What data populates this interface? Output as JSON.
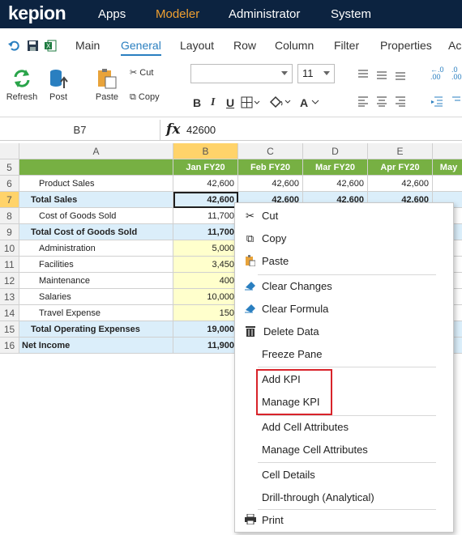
{
  "app": {
    "logo": "kepion"
  },
  "nav": [
    "Apps",
    "Modeler",
    "Administrator",
    "System"
  ],
  "tabs": [
    "Main",
    "General",
    "Layout",
    "Row",
    "Column",
    "Filter",
    "Properties",
    "Ac"
  ],
  "ribbon": {
    "refresh": "Refresh",
    "post": "Post",
    "paste": "Paste",
    "cut": "Cut",
    "copy": "Copy",
    "font_name": "",
    "font_size": "11",
    "bold": "B",
    "italic": "I",
    "underline": "U",
    "font_color": "A",
    "decimal_inc": ".0\n.00",
    "decimal_dec": ".00\n.0"
  },
  "formula_bar": {
    "cell": "B7",
    "fx": "fx",
    "value": "42600"
  },
  "columns": [
    "A",
    "B",
    "C",
    "D",
    "E",
    ""
  ],
  "rows": [
    {
      "num": "5",
      "label": "",
      "values": [
        "Jan FY20",
        "Feb FY20",
        "Mar FY20",
        "Apr FY20",
        "May"
      ]
    },
    {
      "num": "6",
      "label": "Product Sales",
      "values": [
        "42,600",
        "42,600",
        "42,600",
        "42,600",
        ""
      ]
    },
    {
      "num": "7",
      "label": "Total Sales",
      "values": [
        "42,600",
        "42,600",
        "42,600",
        "42,600",
        ""
      ]
    },
    {
      "num": "8",
      "label": "Cost of Goods Sold",
      "values": [
        "11,700",
        "",
        "",
        "",
        ""
      ]
    },
    {
      "num": "9",
      "label": "Total Cost of Goods Sold",
      "values": [
        "11,700",
        "",
        "",
        "",
        ""
      ]
    },
    {
      "num": "10",
      "label": "Administration",
      "values": [
        "5,000",
        "",
        "",
        "",
        ""
      ]
    },
    {
      "num": "11",
      "label": "Facilities",
      "values": [
        "3,450",
        "",
        "",
        "",
        ""
      ]
    },
    {
      "num": "12",
      "label": "Maintenance",
      "values": [
        "400",
        "",
        "",
        "",
        ""
      ]
    },
    {
      "num": "13",
      "label": "Salaries",
      "values": [
        "10,000",
        "",
        "",
        "",
        ""
      ]
    },
    {
      "num": "14",
      "label": "Travel Expense",
      "values": [
        "150",
        "",
        "",
        "",
        ""
      ]
    },
    {
      "num": "15",
      "label": "Total Operating Expenses",
      "values": [
        "19,000",
        "",
        "",
        "",
        ""
      ]
    },
    {
      "num": "16",
      "label": "Net Income",
      "values": [
        "11,900",
        "",
        "",
        "",
        ""
      ]
    }
  ],
  "context_menu": {
    "cut": "Cut",
    "copy": "Copy",
    "paste": "Paste",
    "clear_changes": "Clear Changes",
    "clear_formula": "Clear Formula",
    "delete_data": "Delete Data",
    "freeze_pane": "Freeze Pane",
    "add_kpi": "Add KPI",
    "manage_kpi": "Manage KPI",
    "add_cell_attributes": "Add Cell Attributes",
    "manage_cell_attributes": "Manage Cell Attributes",
    "cell_details": "Cell Details",
    "drill_through": "Drill-through (Analytical)",
    "print": "Print"
  },
  "colors": {
    "header_green": "#77b043",
    "total_blue": "#dbeefa",
    "input_yellow": "#ffffcc",
    "highlight_red": "#d8232a",
    "top_bar": "#0c2340"
  }
}
